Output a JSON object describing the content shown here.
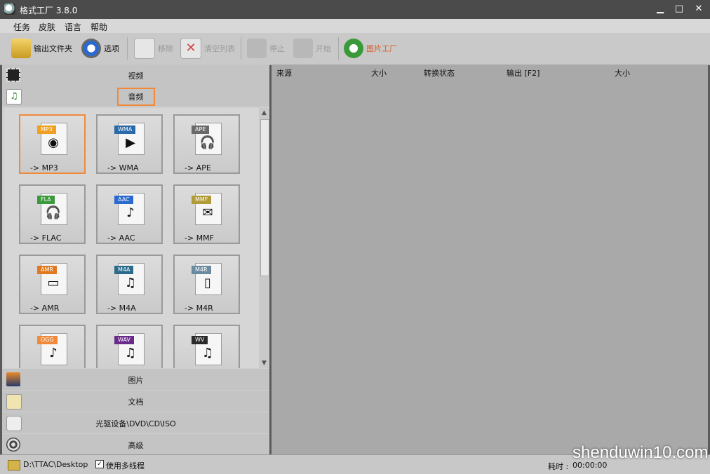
{
  "window": {
    "title": "格式工厂 3.8.0",
    "min": "▁",
    "max": "□",
    "close": "✕"
  },
  "menu": [
    "任务",
    "皮肤",
    "语言",
    "帮助"
  ],
  "toolbar": {
    "output_folder": "输出文件夹",
    "options": "选项",
    "remove": "移除",
    "clear_list": "清空列表",
    "stop": "停止",
    "start": "开始",
    "image_factory": "图片工厂"
  },
  "categories": {
    "video": "视频",
    "audio": "音频",
    "picture": "图片",
    "document": "文档",
    "rom": "光驱设备\\DVD\\CD\\ISO",
    "advanced": "高级"
  },
  "formats": [
    {
      "tag": "MP3",
      "label": "-> MP3",
      "glyph": "◉"
    },
    {
      "tag": "WMA",
      "label": "-> WMA",
      "glyph": "▶"
    },
    {
      "tag": "APE",
      "label": "-> APE",
      "glyph": "🎧"
    },
    {
      "tag": "FLA",
      "label": "-> FLAC",
      "glyph": "🎧"
    },
    {
      "tag": "AAC",
      "label": "-> AAC",
      "glyph": "♪"
    },
    {
      "tag": "MMF",
      "label": "-> MMF",
      "glyph": "✉"
    },
    {
      "tag": "AMR",
      "label": "-> AMR",
      "glyph": "▭"
    },
    {
      "tag": "M4A",
      "label": "-> M4A",
      "glyph": "♫"
    },
    {
      "tag": "M4R",
      "label": "-> M4R",
      "glyph": "▯"
    },
    {
      "tag": "OGG",
      "label": "",
      "glyph": "♪"
    },
    {
      "tag": "WAV",
      "label": "",
      "glyph": "♫"
    },
    {
      "tag": "WV",
      "label": "",
      "glyph": "♫"
    }
  ],
  "tag_colors": [
    "#f0a020",
    "#2a6aa8",
    "#6a6a6a",
    "#3a9a3a",
    "#2a6ad0",
    "#b09a3a",
    "#e07a20",
    "#2a6a8a",
    "#6a8aa0",
    "#f08a3a",
    "#6a2a8a",
    "#2a2a2a"
  ],
  "task_columns": [
    "来源",
    "大小",
    "转换状态",
    "输出 [F2]",
    "大小"
  ],
  "status": {
    "path": "D:\\TTAC\\Desktop",
    "multithread_check": "✓",
    "multithread_label": "使用多线程",
    "elapsed_label": "耗时 :",
    "elapsed_value": "00:00:00"
  },
  "watermark": "shenduwin10.com"
}
